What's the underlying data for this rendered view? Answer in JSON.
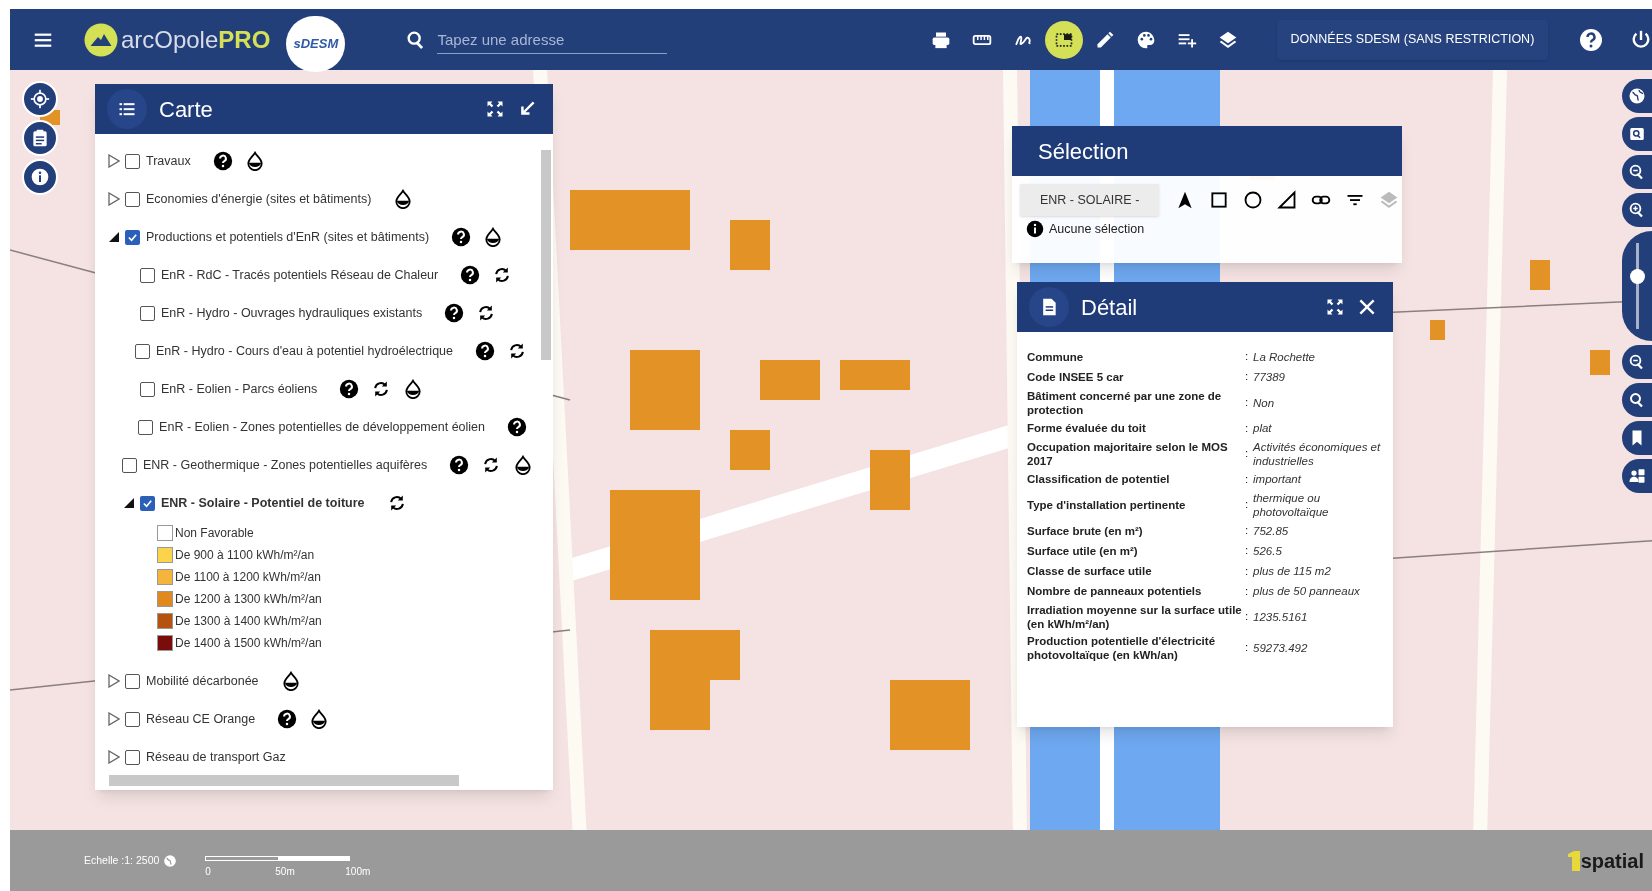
{
  "topbar": {
    "logo_text": "arcOpole",
    "logo_suffix": "PRO",
    "partner_logo": "sDESM",
    "search": {
      "placeholder": "Tapez une adresse"
    },
    "tools": [
      {
        "kind": "print",
        "selected": false
      },
      {
        "kind": "ruler",
        "selected": false
      },
      {
        "kind": "draw",
        "selected": false
      },
      {
        "kind": "select",
        "selected": true
      },
      {
        "kind": "edit",
        "selected": false
      },
      {
        "kind": "palette",
        "selected": false
      },
      {
        "kind": "add-list",
        "selected": false
      },
      {
        "kind": "layers",
        "selected": false
      }
    ],
    "data_button": "DONNÉES SDESM (SANS RESTRICTION)"
  },
  "zoom_slider": {
    "level": 0.6
  },
  "carte": {
    "title": "Carte",
    "layers": [
      {
        "label": "Travaux",
        "checked": false,
        "expanded": false,
        "actions": [
          {
            "kind": "help"
          },
          {
            "kind": "style"
          }
        ]
      },
      {
        "label": "Economies d'énergie (sites et bâtiments)",
        "checked": false,
        "expanded": false,
        "actions": [
          {
            "kind": "style"
          }
        ]
      },
      {
        "label": "Productions et potentiels d'EnR (sites et bâtiments)",
        "checked": true,
        "expanded": true,
        "actions": [
          {
            "kind": "help"
          },
          {
            "kind": "style"
          }
        ],
        "children": [
          {
            "label": "EnR - RdC - Tracés potentiels Réseau de Chaleur",
            "checked": false,
            "actions": [
              {
                "kind": "help"
              },
              {
                "kind": "refresh"
              }
            ]
          },
          {
            "label": "EnR - Hydro - Ouvrages hydrauliques existants",
            "checked": false,
            "actions": [
              {
                "kind": "help"
              },
              {
                "kind": "refresh"
              }
            ]
          },
          {
            "label": "EnR - Hydro - Cours d'eau à potentiel hydroélectrique",
            "checked": false,
            "actions": [
              {
                "kind": "help"
              },
              {
                "kind": "refresh"
              }
            ]
          },
          {
            "label": "EnR - Eolien - Parcs éoliens",
            "checked": false,
            "actions": [
              {
                "kind": "help"
              },
              {
                "kind": "refresh"
              },
              {
                "kind": "style"
              }
            ]
          },
          {
            "label": "EnR - Eolien - Zones potentielles de développement éolien",
            "checked": false,
            "actions": [
              {
                "kind": "help"
              }
            ]
          },
          {
            "label": "ENR - Geothermique - Zones potentielles aquifères",
            "checked": false,
            "actions": [
              {
                "kind": "help"
              },
              {
                "kind": "refresh"
              },
              {
                "kind": "style"
              }
            ]
          },
          {
            "label": "ENR - Solaire - Potentiel de toiture",
            "checked": true,
            "expanded": true,
            "actions": [
              {
                "kind": "refresh"
              }
            ],
            "legend": [
              {
                "label": "Non Favorable",
                "color": "#ffffff"
              },
              {
                "label": "De 900 à 1100 kWh/m²/an",
                "color": "#fcd34d"
              },
              {
                "label": "De 1100 à 1200 kWh/m²/an",
                "color": "#f5b43c"
              },
              {
                "label": "De 1200 à 1300 kWh/m²/an",
                "color": "#e08a1e"
              },
              {
                "label": "De 1300 à 1400 kWh/m²/an",
                "color": "#b4520e"
              },
              {
                "label": "De 1400 à 1500 kWh/m²/an",
                "color": "#7a0c0c"
              }
            ]
          }
        ]
      },
      {
        "label": "Mobilité décarbonée",
        "checked": false,
        "expanded": false,
        "actions": [
          {
            "kind": "style"
          }
        ]
      },
      {
        "label": "Réseau CE Orange",
        "checked": false,
        "expanded": false,
        "actions": [
          {
            "kind": "help"
          },
          {
            "kind": "style"
          }
        ]
      },
      {
        "label": "Réseau de transport Gaz",
        "checked": false,
        "expanded": false
      }
    ]
  },
  "selection": {
    "title": "Sélection",
    "layer_button": "ENR - SOLAIRE -",
    "info": "Aucune sélection"
  },
  "detail": {
    "title": "Détail",
    "rows": [
      {
        "label": "Commune",
        "sep": ":",
        "value": "La Rochette"
      },
      {
        "label": "Code INSEE 5 car",
        "sep": ":",
        "value": "77389"
      },
      {
        "label": "Bâtiment concerné par une zone de protection",
        "sep": ":",
        "value": "Non"
      },
      {
        "label": "Forme évaluée du toit",
        "sep": ":",
        "value": "plat"
      },
      {
        "label": "Occupation majoritaire selon le MOS 2017",
        "sep": ":",
        "value": "Activités économiques et industrielles"
      },
      {
        "label": "Classification de potentiel",
        "sep": ":",
        "value": "important"
      },
      {
        "label": "Type d'installation pertinente",
        "sep": ":",
        "value": "thermique ou photovoltaïque"
      },
      {
        "label": "Surface brute (en m²)",
        "sep": ":",
        "value": "752.85"
      },
      {
        "label": "Surface utile (en m²)",
        "sep": ":",
        "value": "526.5"
      },
      {
        "label": "Classe de surface utile",
        "sep": ":",
        "value": "plus de 115 m2"
      },
      {
        "label": "Nombre de panneaux potentiels",
        "sep": ":",
        "value": "plus de 50 panneaux"
      },
      {
        "label": "Irradiation moyenne sur la surface utile (en kWh/m²/an)",
        "sep": ":",
        "value": "1235.5161"
      },
      {
        "label": "Production potentielle d'électricité photovoltaïque (en kWh/an)",
        "sep": ":",
        "value": "59273.492"
      }
    ]
  },
  "footer": {
    "scale": "Echelle :1: 2500",
    "scale_ticks": [
      "0",
      "50m",
      "100m"
    ],
    "brand": "spatial"
  }
}
